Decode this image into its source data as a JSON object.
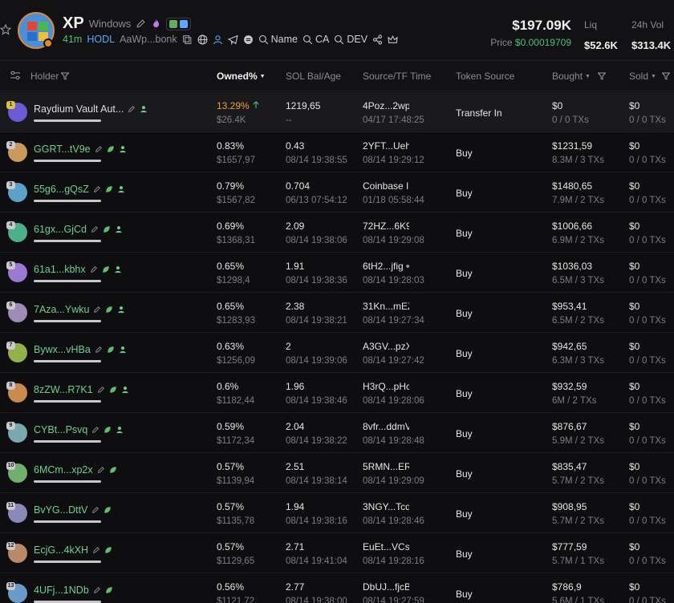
{
  "token": {
    "symbol": "XP",
    "name": "Windows",
    "age": "41m",
    "hodl_label": "HODL",
    "address": "AaWp...bonk",
    "search_links": [
      "Name",
      "CA",
      "DEV"
    ],
    "price_usd_label": "$197.09K",
    "price_label": "Price",
    "price_value": "$0.00019709",
    "liq_label": "Liq",
    "liq_value": "$52.6K",
    "vol_label": "24h Vol",
    "vol_value": "$313.4K"
  },
  "table": {
    "headers": {
      "holder": "Holder",
      "owned": "Owned%",
      "sol": "SOL Bal/Age",
      "source": "Source/TF Time",
      "token_source": "Token Source",
      "bought": "Bought",
      "sold": "Sold"
    },
    "rows": [
      {
        "rank": "1",
        "name": "Raydium Vault Aut...",
        "owned": "13.29%",
        "owned_usd": "$26.4K",
        "sol": "1219,65",
        "age": "--",
        "src": "4Poz...2wp",
        "tf": "04/17 17:48:25",
        "token_source": "Transfer In",
        "bought": "$0",
        "bought_tx": "0 / 0 TXs",
        "sold": "$0",
        "sold_tx": "0 / 0 TXs",
        "avatar": "#6b5bd6"
      },
      {
        "rank": "2",
        "name": "GGRT...tV9e",
        "owned": "0.83%",
        "owned_usd": "$1657,97",
        "sol": "0.43",
        "age": "08/14 19:38:55",
        "src": "2YFT...Ueh",
        "tf": "08/14 19:29:12",
        "token_source": "Buy",
        "bought": "$1231,59",
        "bought_tx": "8.3M / 3 TXs",
        "sold": "$0",
        "sold_tx": "0 / 0 TXs",
        "avatar": "#c99a5b"
      },
      {
        "rank": "3",
        "name": "55g6...gQsZ",
        "owned": "0.79%",
        "owned_usd": "$1567,82",
        "sol": "0.704",
        "age": "06/13 07:54:12",
        "src": "Coinbase I",
        "tf": "01/18 05:58:44",
        "token_source": "Buy",
        "bought": "$1480,65",
        "bought_tx": "7.9M / 2 TXs",
        "sold": "$0",
        "sold_tx": "0 / 0 TXs",
        "avatar": "#5aa0c8"
      },
      {
        "rank": "4",
        "name": "61gx...GjCd",
        "owned": "0.69%",
        "owned_usd": "$1368,31",
        "sol": "2.09",
        "age": "08/14 19:38:06",
        "src": "72HZ...6K9",
        "tf": "08/14 19:29:08",
        "token_source": "Buy",
        "bought": "$1006,66",
        "bought_tx": "6.9M / 2 TXs",
        "sold": "$0",
        "sold_tx": "0 / 0 TXs",
        "avatar": "#4bb08a"
      },
      {
        "rank": "5",
        "name": "61a1...kbhx",
        "owned": "0.65%",
        "owned_usd": "$1298,4",
        "sol": "1.91",
        "age": "08/14 19:38:36",
        "src": "6tH2...jfig",
        "tf": "08/14 19:28:03",
        "token_source": "Buy",
        "bought": "$1036,03",
        "bought_tx": "6.5M / 3 TXs",
        "sold": "$0",
        "sold_tx": "0 / 0 TXs",
        "avatar": "#9a7ad0"
      },
      {
        "rank": "6",
        "name": "7Aza...Ywku",
        "owned": "0.65%",
        "owned_usd": "$1283,93",
        "sol": "2.38",
        "age": "08/14 19:38:21",
        "src": "31Kn...mEZ",
        "tf": "08/14 19:27:34",
        "token_source": "Buy",
        "bought": "$953,41",
        "bought_tx": "6.5M / 2 TXs",
        "sold": "$0",
        "sold_tx": "0 / 0 TXs",
        "avatar": "#a08ab8"
      },
      {
        "rank": "7",
        "name": "Bywx...vHBa",
        "owned": "0.63%",
        "owned_usd": "$1256,09",
        "sol": "2",
        "age": "08/14 19:39:06",
        "src": "A3GV...pzX",
        "tf": "08/14 19:27:42",
        "token_source": "Buy",
        "bought": "$942,65",
        "bought_tx": "6.3M / 3 TXs",
        "sold": "$0",
        "sold_tx": "0 / 0 TXs",
        "avatar": "#8fb24a"
      },
      {
        "rank": "8",
        "name": "8zZW...R7K1",
        "owned": "0.6%",
        "owned_usd": "$1182,44",
        "sol": "1.96",
        "age": "08/14 19:38:46",
        "src": "H3rQ...pHc",
        "tf": "08/14 19:28:06",
        "token_source": "Buy",
        "bought": "$932,59",
        "bought_tx": "6M / 2 TXs",
        "sold": "$0",
        "sold_tx": "0 / 0 TXs",
        "avatar": "#c98a4b"
      },
      {
        "rank": "9",
        "name": "CYBt...Psvq",
        "owned": "0.59%",
        "owned_usd": "$1172,34",
        "sol": "2.04",
        "age": "08/14 19:38:22",
        "src": "8vfr...ddmV",
        "tf": "08/14 19:28:48",
        "token_source": "Buy",
        "bought": "$876,67",
        "bought_tx": "5.9M / 2 TXs",
        "sold": "$0",
        "sold_tx": "0 / 0 TXs",
        "avatar": "#7aa8b0"
      },
      {
        "rank": "10",
        "name": "6MCm...xp2x",
        "owned": "0.57%",
        "owned_usd": "$1139,94",
        "sol": "2.51",
        "age": "08/14 19:38:14",
        "src": "5RMN...ER",
        "tf": "08/14 19:29:09",
        "token_source": "Buy",
        "bought": "$835,47",
        "bought_tx": "5.7M / 2 TXs",
        "sold": "$0",
        "sold_tx": "0 / 0 TXs",
        "avatar": "#6fb06f"
      },
      {
        "rank": "11",
        "name": "BvYG...DttV",
        "owned": "0.57%",
        "owned_usd": "$1135,78",
        "sol": "1.94",
        "age": "08/14 19:38:16",
        "src": "3NGY...Tcd",
        "tf": "08/14 19:28:46",
        "token_source": "Buy",
        "bought": "$908,95",
        "bought_tx": "5.7M / 2 TXs",
        "sold": "$0",
        "sold_tx": "0 / 0 TXs",
        "avatar": "#8a8ab8"
      },
      {
        "rank": "12",
        "name": "EcjG...4kXH",
        "owned": "0.57%",
        "owned_usd": "$1129,65",
        "sol": "2.71",
        "age": "08/14 19:41:04",
        "src": "EuEt...VCs",
        "tf": "08/14 19:28:16",
        "token_source": "Buy",
        "bought": "$777,59",
        "bought_tx": "5.7M / 1 TXs",
        "sold": "$0",
        "sold_tx": "0 / 0 TXs",
        "avatar": "#b88a6a"
      },
      {
        "rank": "13",
        "name": "4UFj...1NDb",
        "owned": "0.56%",
        "owned_usd": "$1121,72",
        "sol": "2.77",
        "age": "08/14 19:38:00",
        "src": "DbUJ...fjcB",
        "tf": "08/14 19:27:59",
        "token_source": "Buy",
        "bought": "$786,9",
        "bought_tx": "5.6M / 1 TXs",
        "sold": "$0",
        "sold_tx": "0 / 0 TXs",
        "avatar": "#6a9ac8"
      }
    ]
  }
}
